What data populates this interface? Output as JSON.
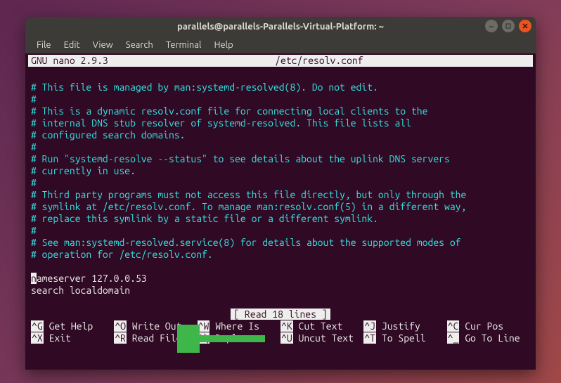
{
  "window": {
    "title": "parallels@parallels-Parallels-Virtual-Platform: ~"
  },
  "menubar": {
    "items": [
      "File",
      "Edit",
      "View",
      "Search",
      "Terminal",
      "Help"
    ]
  },
  "nano": {
    "app": "GNU nano 2.9.3",
    "filename": "/etc/resolv.conf",
    "status": "[ Read 18 lines ]"
  },
  "content": {
    "lines": [
      {
        "type": "comment",
        "text": "# This file is managed by man:systemd-resolved(8). Do not edit."
      },
      {
        "type": "comment",
        "text": "#"
      },
      {
        "type": "comment",
        "text": "# This is a dynamic resolv.conf file for connecting local clients to the"
      },
      {
        "type": "comment",
        "text": "# internal DNS stub resolver of systemd-resolved. This file lists all"
      },
      {
        "type": "comment",
        "text": "# configured search domains."
      },
      {
        "type": "comment",
        "text": "#"
      },
      {
        "type": "comment",
        "text": "# Run \"systemd-resolve --status\" to see details about the uplink DNS servers"
      },
      {
        "type": "comment",
        "text": "# currently in use."
      },
      {
        "type": "comment",
        "text": "#"
      },
      {
        "type": "comment",
        "text": "# Third party programs must not access this file directly, but only through the"
      },
      {
        "type": "comment",
        "text": "# symlink at /etc/resolv.conf. To manage man:resolv.conf(5) in a different way,"
      },
      {
        "type": "comment",
        "text": "# replace this symlink by a static file or a different symlink."
      },
      {
        "type": "comment",
        "text": "#"
      },
      {
        "type": "comment",
        "text": "# See man:systemd-resolved.service(8) for details about the supported modes of"
      },
      {
        "type": "comment",
        "text": "# operation for /etc/resolv.conf."
      }
    ],
    "cursor_line_first_char": "n",
    "cursor_line_rest": "ameserver 127.0.0.53",
    "last_line": "search localdomain"
  },
  "shortcuts": {
    "row1": [
      {
        "key": "^G",
        "label": "Get Help"
      },
      {
        "key": "^O",
        "label": "Write Out"
      },
      {
        "key": "^W",
        "label": "Where Is"
      },
      {
        "key": "^K",
        "label": "Cut Text"
      },
      {
        "key": "^J",
        "label": "Justify"
      },
      {
        "key": "^C",
        "label": "Cur Pos"
      }
    ],
    "row2": [
      {
        "key": "^X",
        "label": "Exit"
      },
      {
        "key": "^R",
        "label": "Read File"
      },
      {
        "key": "^\\",
        "label": "Replace"
      },
      {
        "key": "^U",
        "label": "Uncut Text"
      },
      {
        "key": "^T",
        "label": "To Spell"
      },
      {
        "key": "^_",
        "label": "Go To Line"
      }
    ]
  },
  "annotation": {
    "arrow_color": "#3eb649"
  }
}
